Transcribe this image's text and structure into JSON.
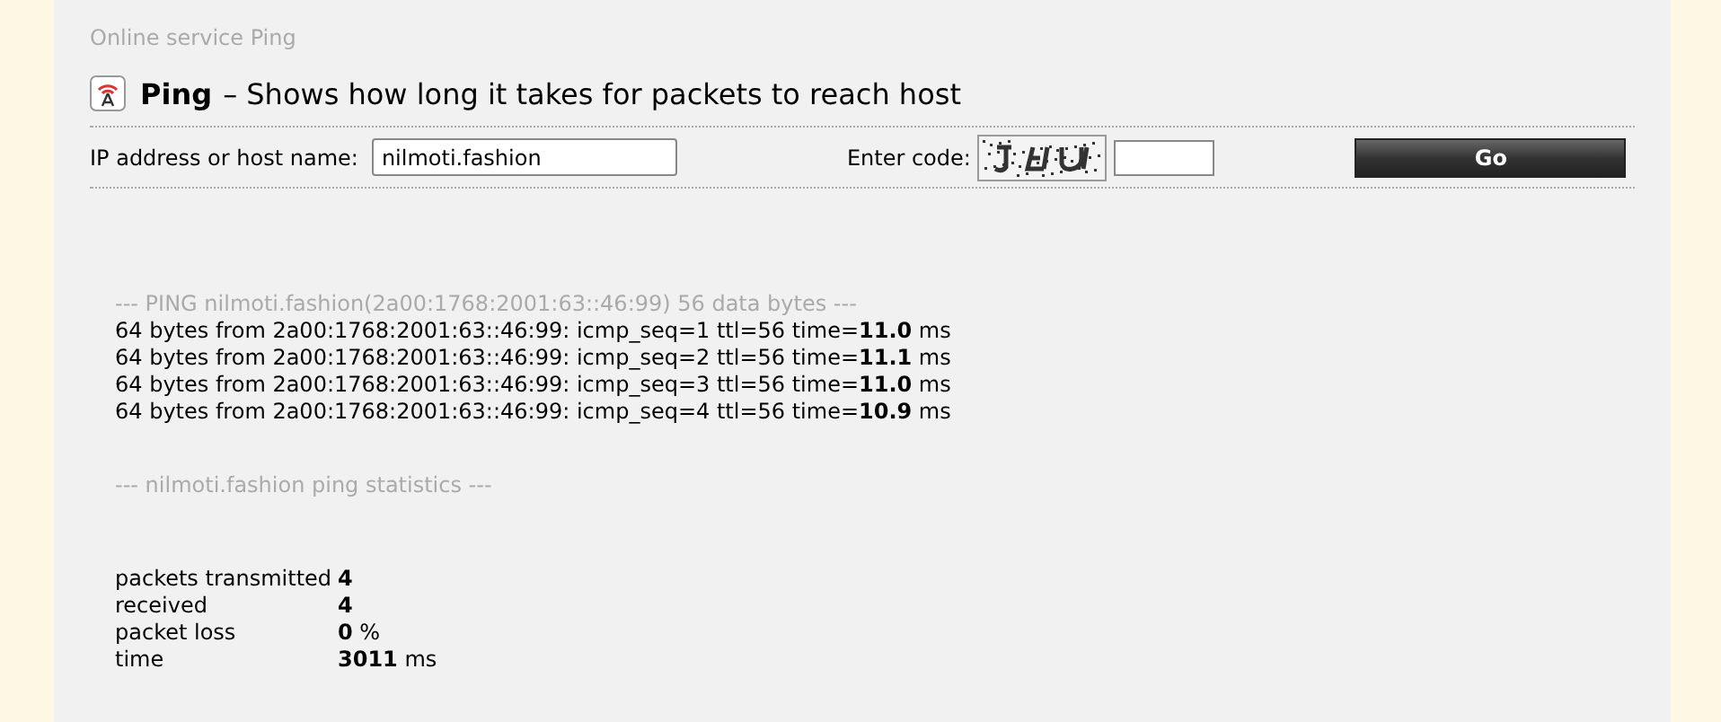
{
  "breadcrumb": "Online service Ping",
  "heading": {
    "title": "Ping",
    "subtitle": "– Shows how long it takes for packets to reach host"
  },
  "form": {
    "host_label": "IP address or host name:",
    "host_value": "nilmoti.fashion",
    "code_label": "Enter code:",
    "go_button": "Go"
  },
  "ping_header": "--- PING nilmoti.fashion(2a00:1768:2001:63::46:99) 56 data bytes ---",
  "ping_lines": [
    "64 bytes from 2a00:1768:2001:63::46:99: icmp_seq=1 ttl=56 time=**11.0** ms",
    "64 bytes from 2a00:1768:2001:63::46:99: icmp_seq=2 ttl=56 time=**11.1** ms",
    "64 bytes from 2a00:1768:2001:63::46:99: icmp_seq=3 ttl=56 time=**11.0** ms",
    "64 bytes from 2a00:1768:2001:63::46:99: icmp_seq=4 ttl=56 time=**10.9** ms"
  ],
  "stats_header": "--- nilmoti.fashion ping statistics ---",
  "stats": [
    {
      "label": "packets transmitted",
      "value": "**4**"
    },
    {
      "label": "received",
      "value": "**4**"
    },
    {
      "label": "packet loss",
      "value": "**0** %"
    },
    {
      "label": "time",
      "value": "**3011** ms"
    }
  ]
}
